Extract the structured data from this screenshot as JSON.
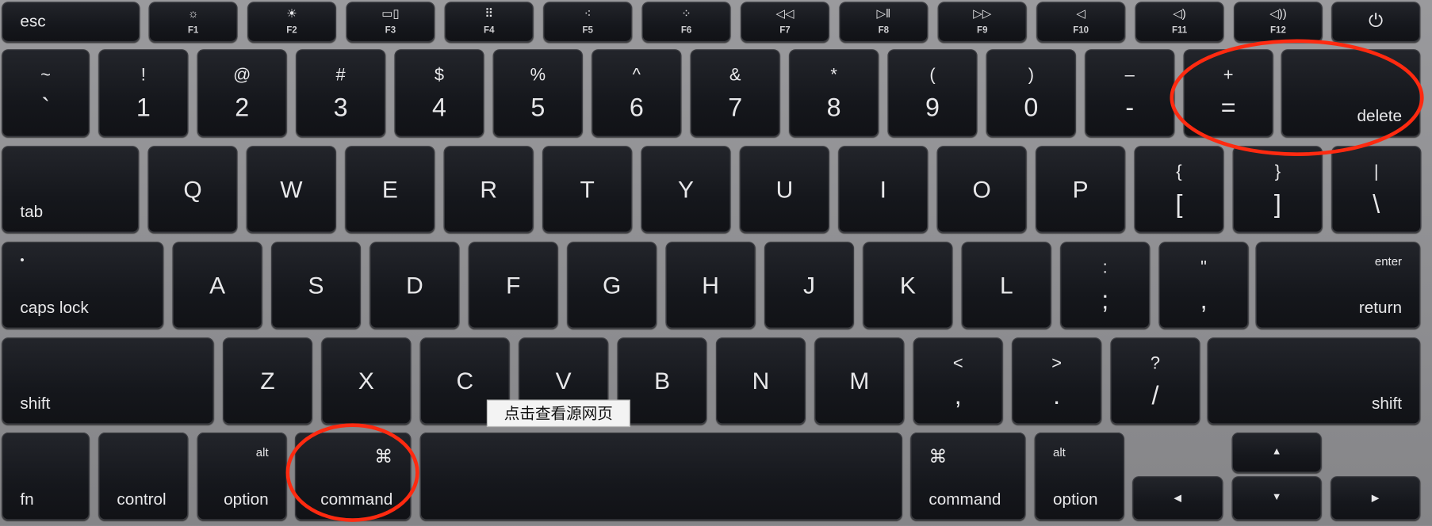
{
  "annotation_color": "#ff2a10",
  "tooltip": "点击查看源网页",
  "function_row": [
    {
      "label": "esc"
    },
    {
      "label": "F1",
      "icon": "brightness-down-icon"
    },
    {
      "label": "F2",
      "icon": "brightness-up-icon"
    },
    {
      "label": "F3",
      "icon": "mission-control-icon"
    },
    {
      "label": "F4",
      "icon": "launchpad-icon"
    },
    {
      "label": "F5",
      "icon": "keyboard-light-down-icon"
    },
    {
      "label": "F6",
      "icon": "keyboard-light-up-icon"
    },
    {
      "label": "F7",
      "icon": "rewind-icon"
    },
    {
      "label": "F8",
      "icon": "play-pause-icon"
    },
    {
      "label": "F9",
      "icon": "fast-forward-icon"
    },
    {
      "label": "F10",
      "icon": "mute-icon"
    },
    {
      "label": "F11",
      "icon": "volume-down-icon"
    },
    {
      "label": "F12",
      "icon": "volume-up-icon"
    },
    {
      "label": "",
      "icon": "power-icon"
    }
  ],
  "number_row": [
    {
      "top": "~",
      "bottom": "`"
    },
    {
      "top": "!",
      "bottom": "1"
    },
    {
      "top": "@",
      "bottom": "2"
    },
    {
      "top": "#",
      "bottom": "3"
    },
    {
      "top": "$",
      "bottom": "4"
    },
    {
      "top": "%",
      "bottom": "5"
    },
    {
      "top": "^",
      "bottom": "6"
    },
    {
      "top": "&",
      "bottom": "7"
    },
    {
      "top": "*",
      "bottom": "8"
    },
    {
      "top": "(",
      "bottom": "9"
    },
    {
      "top": ")",
      "bottom": "0"
    },
    {
      "top": "–",
      "bottom": "-"
    },
    {
      "top": "+",
      "bottom": "="
    },
    {
      "label": "delete"
    }
  ],
  "qwerty_row": [
    {
      "label": "tab"
    },
    {
      "letter": "Q"
    },
    {
      "letter": "W"
    },
    {
      "letter": "E"
    },
    {
      "letter": "R"
    },
    {
      "letter": "T"
    },
    {
      "letter": "Y"
    },
    {
      "letter": "U"
    },
    {
      "letter": "I"
    },
    {
      "letter": "O"
    },
    {
      "letter": "P"
    },
    {
      "top": "{",
      "bottom": "["
    },
    {
      "top": "}",
      "bottom": "]"
    },
    {
      "top": "|",
      "bottom": "\\"
    }
  ],
  "home_row": [
    {
      "label": "caps lock",
      "top_glyph": "•"
    },
    {
      "letter": "A"
    },
    {
      "letter": "S"
    },
    {
      "letter": "D"
    },
    {
      "letter": "F"
    },
    {
      "letter": "G"
    },
    {
      "letter": "H"
    },
    {
      "letter": "J"
    },
    {
      "letter": "K"
    },
    {
      "letter": "L"
    },
    {
      "top": ":",
      "bottom": ";"
    },
    {
      "top": "\"",
      "bottom": ","
    },
    {
      "label": "return",
      "top_glyph": "enter"
    }
  ],
  "shift_row": [
    {
      "label": "shift"
    },
    {
      "letter": "Z"
    },
    {
      "letter": "X"
    },
    {
      "letter": "C"
    },
    {
      "letter": "V"
    },
    {
      "letter": "B"
    },
    {
      "letter": "N"
    },
    {
      "letter": "M"
    },
    {
      "top": "<",
      "bottom": ","
    },
    {
      "top": ">",
      "bottom": "."
    },
    {
      "top": "?",
      "bottom": "/"
    },
    {
      "label": "shift"
    }
  ],
  "bottom_row": [
    {
      "label": "fn"
    },
    {
      "label": "control"
    },
    {
      "label": "option",
      "top_glyph": "alt"
    },
    {
      "label": "command",
      "top_glyph": "⌘"
    },
    {
      "label": ""
    },
    {
      "label": "command",
      "top_glyph": "⌘"
    },
    {
      "label": "option",
      "top_glyph": "alt"
    },
    {
      "icon": "arrow-left-icon"
    },
    {
      "icon": "arrow-up-icon"
    },
    {
      "icon": "arrow-down-icon"
    },
    {
      "icon": "arrow-right-icon"
    }
  ]
}
